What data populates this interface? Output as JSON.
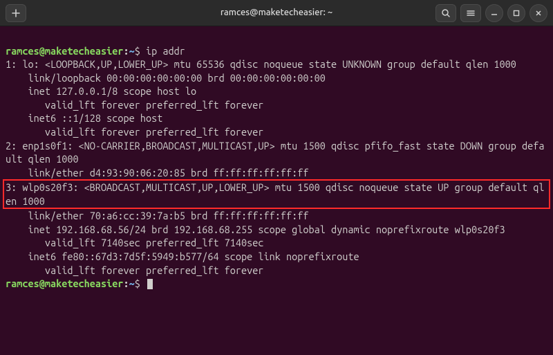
{
  "window": {
    "title": "ramces@maketecheasier: ~"
  },
  "prompt": {
    "userhost": "ramces@maketecheasier",
    "colon": ":",
    "path": "~",
    "dollar": "$"
  },
  "cmd1": "ip addr",
  "out": {
    "l01": "1: lo: <LOOPBACK,UP,LOWER_UP> mtu 65536 qdisc noqueue state UNKNOWN group default qlen 1000",
    "l02": "    link/loopback 00:00:00:00:00:00 brd 00:00:00:00:00:00",
    "l03": "    inet 127.0.0.1/8 scope host lo",
    "l04": "       valid_lft forever preferred_lft forever",
    "l05": "    inet6 ::1/128 scope host",
    "l06": "       valid_lft forever preferred_lft forever",
    "l07": "2: enp1s0f1: <NO-CARRIER,BROADCAST,MULTICAST,UP> mtu 1500 qdisc pfifo_fast state DOWN group default qlen 1000",
    "l08": "    link/ether d4:93:90:06:20:85 brd ff:ff:ff:ff:ff:ff",
    "l09": "3: wlp0s20f3: <BROADCAST,MULTICAST,UP,LOWER_UP> mtu 1500 qdisc noqueue state UP group default qlen 1000",
    "l10": "    link/ether 70:a6:cc:39:7a:b5 brd ff:ff:ff:ff:ff:ff",
    "l11": "    inet 192.168.68.56/24 brd 192.168.68.255 scope global dynamic noprefixroute wlp0s20f3",
    "l12": "       valid_lft 7140sec preferred_lft 7140sec",
    "l13": "    inet6 fe80::67d3:7d5f:5949:b577/64 scope link noprefixroute",
    "l14": "       valid_lft forever preferred_lft forever"
  }
}
